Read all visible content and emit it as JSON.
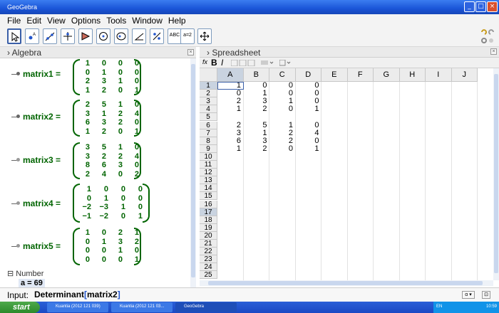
{
  "window": {
    "title": "GeoGebra"
  },
  "menu": [
    "File",
    "Edit",
    "View",
    "Options",
    "Tools",
    "Window",
    "Help"
  ],
  "toolbar": {
    "abc_label": "ABC",
    "slider_label": "a=2"
  },
  "algebra": {
    "title": "Algebra",
    "matrices": [
      {
        "name": "matrix1 =",
        "rows": [
          [
            "1",
            "0",
            "0",
            "0"
          ],
          [
            "0",
            "1",
            "0",
            "0"
          ],
          [
            "2",
            "3",
            "1",
            "0"
          ],
          [
            "1",
            "2",
            "0",
            "1"
          ]
        ]
      },
      {
        "name": "matrix2 =",
        "rows": [
          [
            "2",
            "5",
            "1",
            "0"
          ],
          [
            "3",
            "1",
            "2",
            "4"
          ],
          [
            "6",
            "3",
            "2",
            "0"
          ],
          [
            "1",
            "2",
            "0",
            "1"
          ]
        ]
      },
      {
        "name": "matrix3 =",
        "rows": [
          [
            "3",
            "5",
            "1",
            "0"
          ],
          [
            "3",
            "2",
            "2",
            "4"
          ],
          [
            "8",
            "6",
            "3",
            "0"
          ],
          [
            "2",
            "4",
            "0",
            "2"
          ]
        ]
      },
      {
        "name": "matrix4 =",
        "rows": [
          [
            "1",
            "0",
            "0",
            "0"
          ],
          [
            "0",
            "1",
            "0",
            "0"
          ],
          [
            "−2",
            "−3",
            "1",
            "0"
          ],
          [
            "−1",
            "−2",
            "0",
            "1"
          ]
        ]
      },
      {
        "name": "matrix5 =",
        "rows": [
          [
            "1",
            "0",
            "2",
            "1"
          ],
          [
            "0",
            "1",
            "3",
            "2"
          ],
          [
            "0",
            "0",
            "1",
            "0"
          ],
          [
            "0",
            "0",
            "0",
            "1"
          ]
        ]
      }
    ],
    "number_header": "Number",
    "number_item": "a = 69"
  },
  "spreadsheet": {
    "title": "Spreadsheet",
    "fx": "fx",
    "bold": "B",
    "italic": "I",
    "columns": [
      "A",
      "B",
      "C",
      "D",
      "E",
      "F",
      "G",
      "H",
      "I",
      "J"
    ],
    "rows": [
      "1",
      "2",
      "3",
      "4",
      "5",
      "6",
      "7",
      "8",
      "9",
      "10",
      "11",
      "12",
      "13",
      "14",
      "15",
      "16",
      "17",
      "18",
      "19",
      "20",
      "21",
      "22",
      "23",
      "24",
      "25"
    ],
    "data": [
      [
        "1",
        "0",
        "0",
        "0"
      ],
      [
        "0",
        "1",
        "0",
        "0"
      ],
      [
        "2",
        "3",
        "1",
        "0"
      ],
      [
        "1",
        "2",
        "0",
        "1"
      ],
      [
        "",
        "",
        "",
        ""
      ],
      [
        "2",
        "5",
        "1",
        "0"
      ],
      [
        "3",
        "1",
        "2",
        "4"
      ],
      [
        "6",
        "3",
        "2",
        "0"
      ],
      [
        "1",
        "2",
        "0",
        "1"
      ]
    ]
  },
  "input": {
    "label": "Input:",
    "command": "Determinant",
    "open": "[",
    "arg": "matrix2",
    "close": "]"
  },
  "taskbar": {
    "start": "start",
    "tasks": [
      "Kuantia (2012 121 039)",
      "Kuantia (2012 121 03...",
      "GeoGebra"
    ],
    "tray_lang": "EN",
    "tray_time": "10:59"
  }
}
